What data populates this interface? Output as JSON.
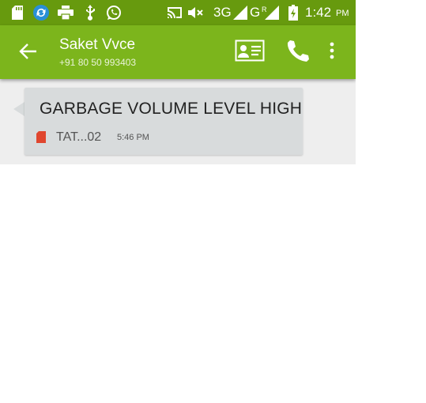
{
  "status_bar": {
    "icons": [
      "sd-card-icon",
      "sync-icon",
      "printer-icon",
      "usb-icon",
      "whatsapp-icon",
      "cast-icon",
      "mute-icon"
    ],
    "network_1": "3G",
    "network_2": "G",
    "network_2_sup": "R",
    "time": "1:42",
    "time_suffix": "PM",
    "colors": {
      "background": "#679a0e"
    }
  },
  "app_bar": {
    "contact_name": "Saket Vvce",
    "contact_number": "+91 80 50 993403",
    "actions": [
      "contact-card-icon",
      "call-icon",
      "more-options-icon"
    ],
    "colors": {
      "background": "#7cb51c"
    }
  },
  "messages": [
    {
      "text": "GARBAGE VOLUME LEVEL HIGH",
      "sim": "TAT...02",
      "time": "5:46 PM",
      "colors": {
        "bubble": "#d8dbdc",
        "sim_icon": "#e0462e"
      }
    }
  ]
}
